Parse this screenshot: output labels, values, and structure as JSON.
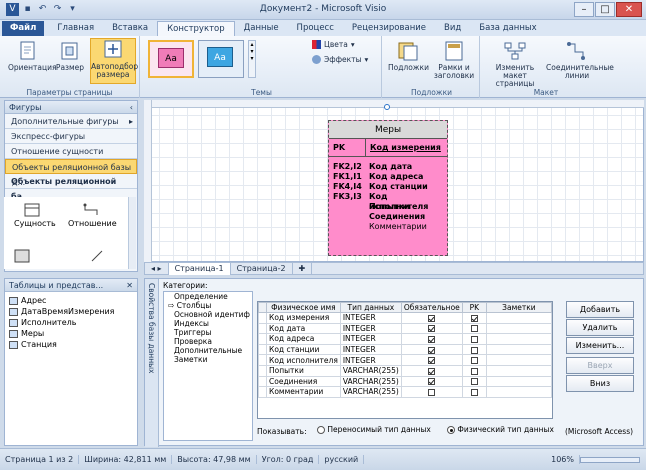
{
  "window": {
    "title": "Документ2 - Microsoft Visio"
  },
  "tabs": [
    "Файл",
    "Главная",
    "Вставка",
    "Конструктор",
    "Данные",
    "Процесс",
    "Рецензирование",
    "Вид",
    "База данных"
  ],
  "ribbon": {
    "page_setup": {
      "orientation": "Ориентация",
      "size": "Размер",
      "autofit": "Автоподбор размера",
      "label": "Параметры страницы"
    },
    "themes": {
      "label": "Темы",
      "thumb": "Aa",
      "colors": "Цвета",
      "effects": "Эффекты"
    },
    "backgrounds": {
      "backgrounds": "Подложки",
      "borders": "Рамки и заголовки",
      "label": "Подложки"
    },
    "layout": {
      "relayout": "Изменить макет страницы",
      "connectors": "Соединительные линии",
      "label": "Макет"
    }
  },
  "shapes_pane": {
    "header": "Фигуры",
    "items": [
      "Дополнительные фигуры",
      "Экспресс-фигуры",
      "Отношение сущности",
      "Объекты реляционной базы д...",
      "Объекты реляционной ба..."
    ],
    "stencil": [
      "Сущность",
      "Отношение"
    ]
  },
  "entity": {
    "title": "Меры",
    "pk_key": "PK",
    "pk_field": "Код измерения",
    "rows": [
      {
        "k": "FK2,I2",
        "v": "Код дата"
      },
      {
        "k": "FK1,I1",
        "v": "Код адреса"
      },
      {
        "k": "FK4,I4",
        "v": "Код станции"
      },
      {
        "k": "FK3,I3",
        "v": "Код исполнителя"
      },
      {
        "k": "",
        "v": "Попытки"
      },
      {
        "k": "",
        "v": "Соединения"
      },
      {
        "k": "",
        "v": "Комментарии"
      }
    ]
  },
  "sheets": [
    "Страница-1",
    "Страница-2"
  ],
  "tables_pane": {
    "header": "Таблицы и представ...",
    "items": [
      "Адрес",
      "ДатаВремяИзмерения",
      "Исполнитель",
      "Меры",
      "Станция"
    ]
  },
  "db_props": {
    "vtitle": "Свойства базы данных",
    "categories_label": "Категории:",
    "categories": [
      "Определение",
      "Столбцы",
      "Основной идентиф",
      "Индексы",
      "Триггеры",
      "Проверка",
      "Дополнительные",
      "Заметки"
    ],
    "headers": [
      "Физическое имя",
      "Тип данных",
      "Обязательное",
      "PK",
      "Заметки"
    ],
    "rows": [
      {
        "name": "Код измерения",
        "type": "INTEGER",
        "req": true,
        "pk": true
      },
      {
        "name": "Код дата",
        "type": "INTEGER",
        "req": true,
        "pk": false
      },
      {
        "name": "Код адреса",
        "type": "INTEGER",
        "req": true,
        "pk": false
      },
      {
        "name": "Код станции",
        "type": "INTEGER",
        "req": true,
        "pk": false
      },
      {
        "name": "Код исполнителя",
        "type": "INTEGER",
        "req": true,
        "pk": false
      },
      {
        "name": "Попытки",
        "type": "VARCHAR(255)",
        "req": true,
        "pk": false
      },
      {
        "name": "Соединения",
        "type": "VARCHAR(255)",
        "req": true,
        "pk": false
      },
      {
        "name": "Комментарии",
        "type": "VARCHAR(255)",
        "req": false,
        "pk": false
      }
    ],
    "buttons": {
      "add": "Добавить",
      "remove": "Удалить",
      "edit": "Изменить...",
      "up": "Вверх",
      "down": "Вниз"
    },
    "show_label": "Показывать:",
    "portable": "Переносимый тип данных",
    "physical": "Физический тип данных",
    "provider": "(Microsoft Access)"
  },
  "status": {
    "page": "Страница 1 из 2",
    "width": "Ширина: 42,811 мм",
    "height": "Высота: 47,98 мм",
    "angle": "Угол: 0 град",
    "lang": "русский",
    "zoom": "106%"
  }
}
